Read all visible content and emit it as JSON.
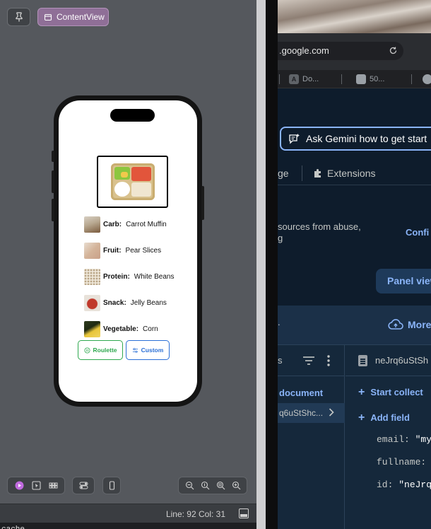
{
  "canvas": {
    "chip_label": "ContentView",
    "food_items": [
      {
        "key": "Carb:",
        "value": "Carrot Muffin",
        "icon": "carrot-muffin-image"
      },
      {
        "key": "Fruit:",
        "value": "Pear Slices",
        "icon": "pear-slices-image"
      },
      {
        "key": "Protein:",
        "value": "White Beans",
        "icon": "white-beans-image"
      },
      {
        "key": "Snack:",
        "value": "Jelly Beans",
        "icon": "jelly-beans-image"
      },
      {
        "key": "Vegetable:",
        "value": "Corn",
        "icon": "corn-image"
      }
    ],
    "buttons": {
      "roulette": "Roulette",
      "custom": "Custom"
    },
    "status": "Line: 92  Col: 31",
    "console_text": "cache"
  },
  "browser": {
    "address": ".google.com",
    "tabs": [
      {
        "label": "Do..."
      },
      {
        "label": "50..."
      }
    ],
    "gemini_label": "Ask Gemini how to get start",
    "nav_partial": "ge",
    "nav_extensions": "Extensions",
    "abuse_text": "sources from abuse,",
    "abuse_text2": "g",
    "configure_label": "Confi",
    "panel_view_label": "Panel view",
    "panel_dot": ".",
    "more_label": "More",
    "col1_header": "s",
    "add_document_label": "document",
    "doc_id": "q6uStShc...",
    "col2_title": "neJrq6uStSh",
    "start_collection_label": "Start collect",
    "add_field_label": "Add field",
    "fields": [
      {
        "key": "email:",
        "value": "\"my"
      },
      {
        "key": "fullname:",
        "value": ""
      },
      {
        "key": "id:",
        "value": "\"neJrq6"
      }
    ]
  },
  "colors": {
    "roulette": "#2fa84f",
    "custom": "#2a6fd6",
    "firebase_link": "#8ab4f8",
    "chip": "#8f6f97"
  }
}
